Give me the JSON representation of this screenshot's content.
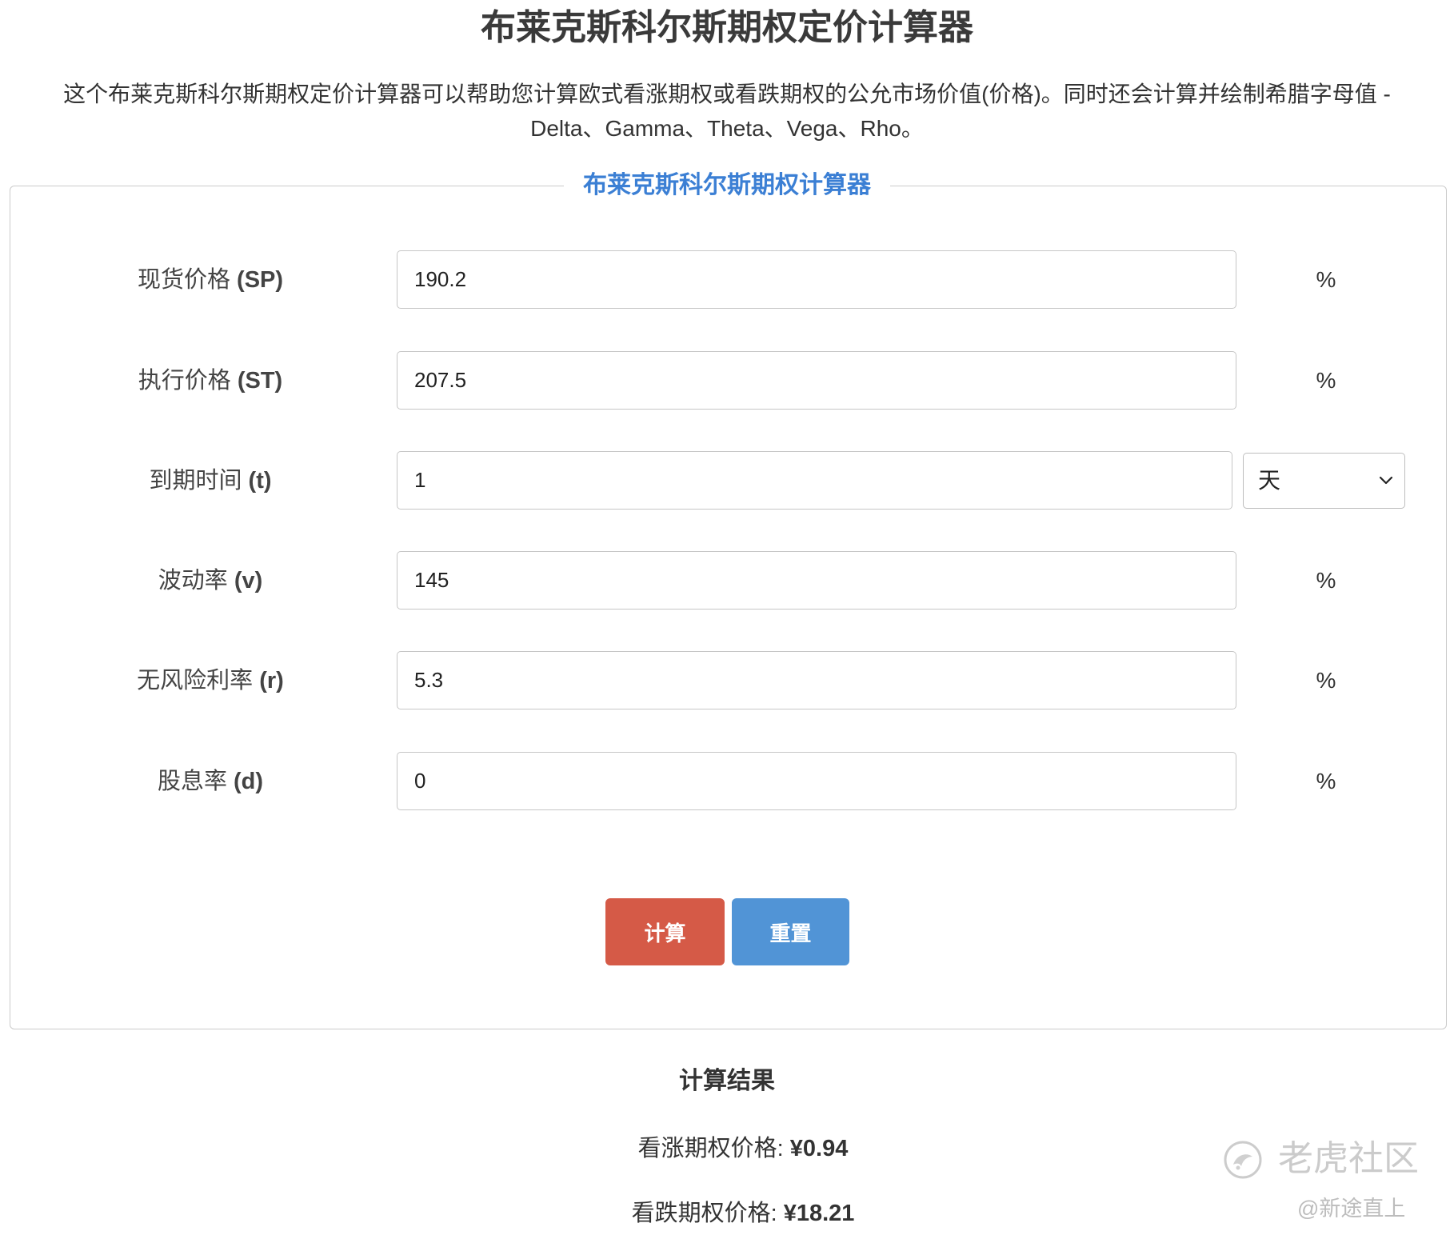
{
  "page": {
    "title": "布莱克斯科尔斯期权定价计算器",
    "description_lines": [
      "这个布莱克斯科尔斯期权定价计算器可以帮助您计算欧式看涨期权或看跌期权的公允市场价值(价格)。同时还会计算并绘制希腊字母值 -",
      "Delta、Gamma、Theta、Vega、Rho。"
    ]
  },
  "form": {
    "legend": "布莱克斯科尔斯期权计算器",
    "fields": [
      {
        "label": "现货价格",
        "symbol": "(SP)",
        "value": "190.2",
        "unit": "%"
      },
      {
        "label": "执行价格",
        "symbol": "(ST)",
        "value": "207.5",
        "unit": "%"
      },
      {
        "label": "到期时间",
        "symbol": "(t)",
        "value": "1"
      },
      {
        "label": "波动率",
        "symbol": "(v)",
        "value": "145",
        "unit": "%"
      },
      {
        "label": "无风险利率",
        "symbol": "(r)",
        "value": "5.3",
        "unit": "%"
      },
      {
        "label": "股息率",
        "symbol": "(d)",
        "value": "0",
        "unit": "%"
      }
    ],
    "time_unit_select": {
      "selected": "天",
      "icon": "chevron-down-icon"
    },
    "buttons": {
      "calculate": "计算",
      "reset": "重置"
    }
  },
  "results": {
    "heading": "计算结果",
    "call_label": "看涨期权价格:",
    "call_value": "¥0.94",
    "put_label": "看跌期权价格:",
    "put_value": "¥18.21"
  },
  "watermark": {
    "brand": "老虎社区",
    "author": "@新途直上",
    "icon": "tiger-logo-icon"
  },
  "colors": {
    "legend": "#3b7fd4",
    "calculate_button": "#d55a47",
    "reset_button": "#5194d6"
  }
}
